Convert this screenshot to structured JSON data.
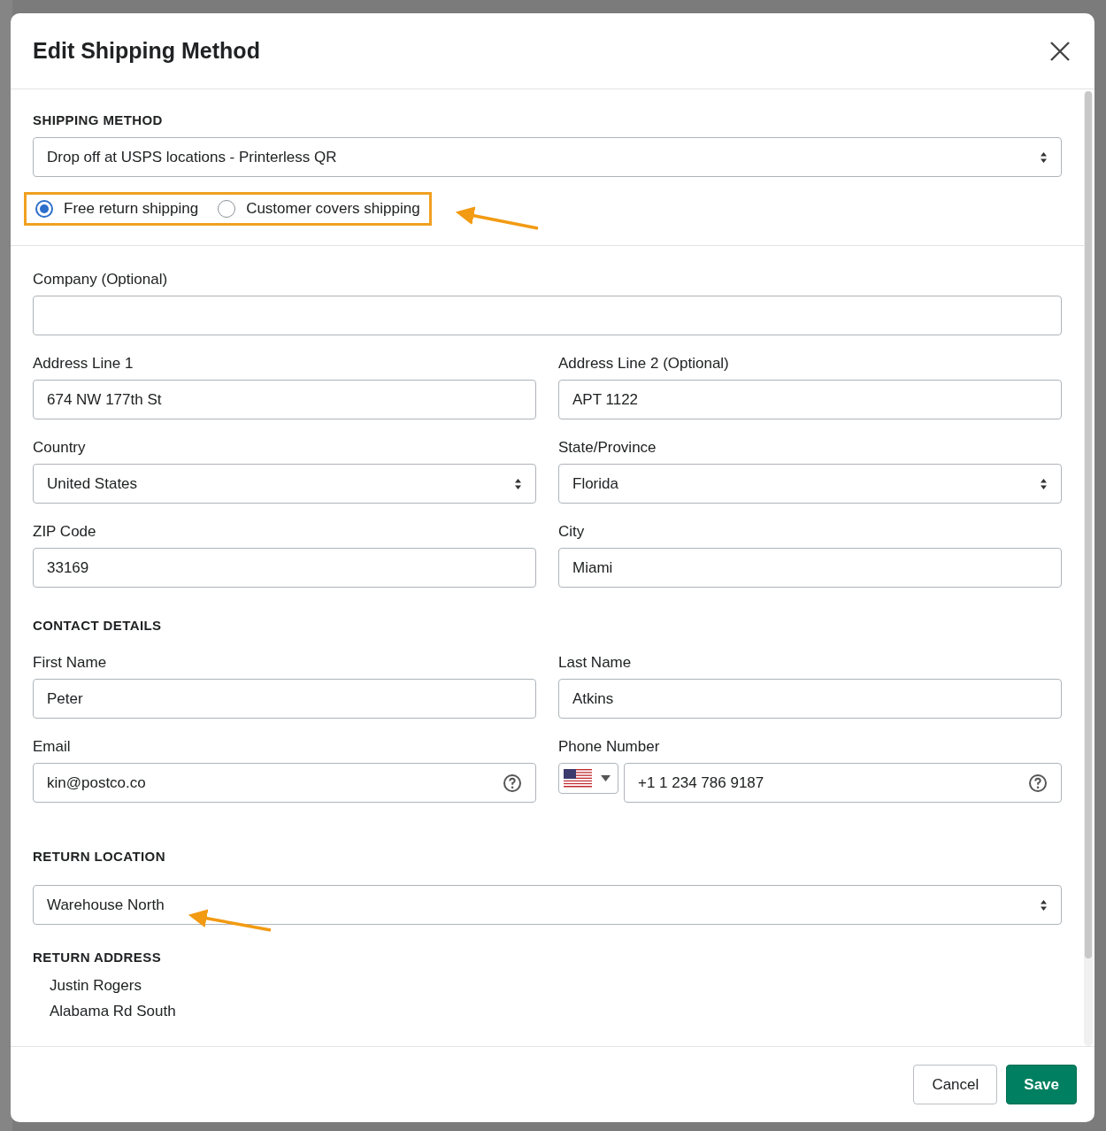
{
  "dialog": {
    "title": "Edit Shipping Method"
  },
  "shipping_method": {
    "heading": "SHIPPING METHOD",
    "value": "Drop off at USPS locations - Printerless QR",
    "highlighted": true,
    "options": [
      {
        "label": "Free return shipping",
        "selected": true
      },
      {
        "label": "Customer covers shipping",
        "selected": false
      }
    ]
  },
  "company": {
    "label": "Company (Optional)"
  },
  "address_fields": [
    {
      "label": "Address Line 1",
      "value": "674 NW 177th St",
      "kind": "input"
    },
    {
      "label": "Address Line 2 (Optional)",
      "value": "APT 1122",
      "kind": "input"
    },
    {
      "label": "Country",
      "value": "United States",
      "kind": "select"
    },
    {
      "label": "State/Province",
      "value": "Florida",
      "kind": "select"
    },
    {
      "label": "ZIP Code",
      "value": "33169",
      "kind": "input"
    },
    {
      "label": "City",
      "value": "Miami",
      "kind": "input"
    }
  ],
  "contact_details": {
    "heading": "CONTACT DETAILS",
    "fields": [
      {
        "label": "First Name",
        "value": "Peter",
        "kind": "input"
      },
      {
        "label": "Last Name",
        "value": "Atkins",
        "kind": "input"
      },
      {
        "label": "Email",
        "value": "kin@postco.co",
        "kind": "help"
      },
      {
        "label": "Phone Number",
        "value": "+1 1 234 786 9187",
        "kind": "phone"
      }
    ]
  },
  "return_location": {
    "heading": "RETURN LOCATION",
    "value": "Warehouse North"
  },
  "return_address": {
    "heading": "RETURN ADDRESS",
    "lines": [
      "Justin Rogers",
      "Alabama Rd South"
    ]
  },
  "buttons": [
    {
      "label": "Cancel",
      "kind": "secondary"
    },
    {
      "label": "Save",
      "kind": "primary"
    }
  ]
}
